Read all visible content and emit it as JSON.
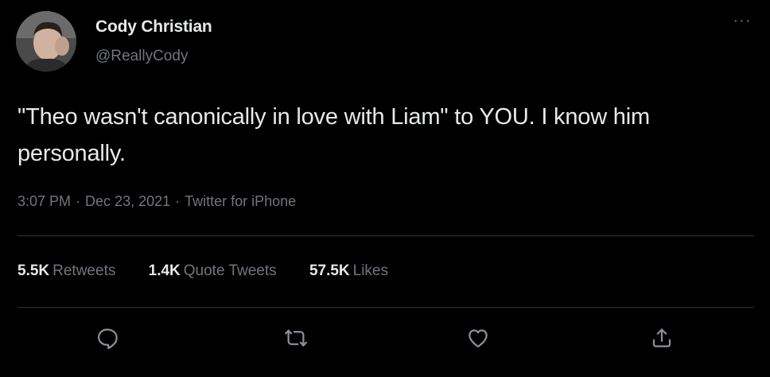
{
  "author": {
    "display_name": "Cody Christian",
    "handle": "@ReallyCody"
  },
  "tweet": {
    "text": "\"Theo wasn't canonically in love with Liam\" to YOU. I know him personally.",
    "time": "3:07 PM",
    "separator": "·",
    "date": "Dec 23, 2021",
    "source": "Twitter for iPhone"
  },
  "stats": {
    "retweets_count": "5.5K",
    "retweets_label": "Retweets",
    "quotes_count": "1.4K",
    "quotes_label": "Quote Tweets",
    "likes_count": "57.5K",
    "likes_label": "Likes"
  },
  "more_label": "···",
  "icons": {
    "reply": "reply-icon",
    "retweet": "retweet-icon",
    "like": "heart-icon",
    "share": "share-icon"
  },
  "colors": {
    "background": "#000000",
    "primary_text": "#e7e9ea",
    "secondary_text": "#71767b",
    "divider": "#2f3336"
  }
}
